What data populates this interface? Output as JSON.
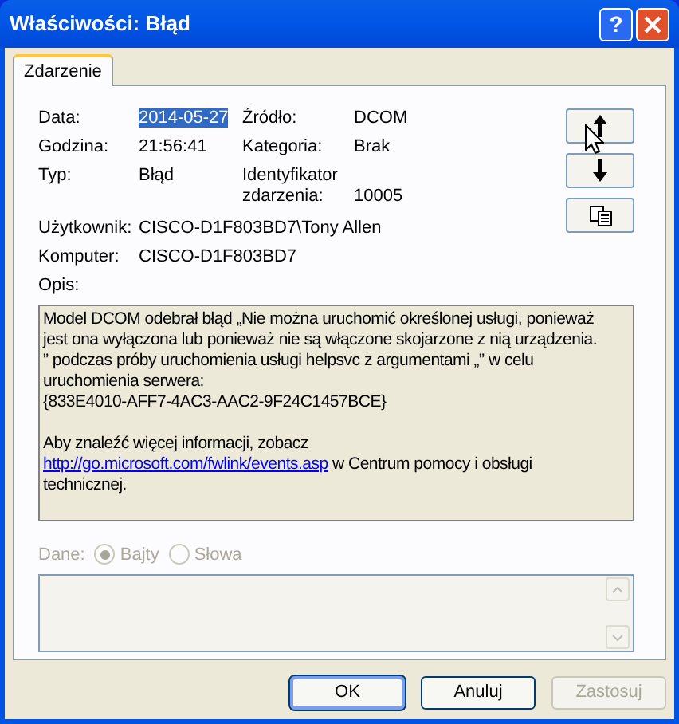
{
  "window": {
    "title": "Właściwości: Błąd",
    "help": "?"
  },
  "tabs": [
    {
      "label": "Zdarzenie",
      "selected": true
    }
  ],
  "header_fields": [
    {
      "label": "Data:",
      "value": "2014-05-27",
      "selected": true
    },
    {
      "label": "Źródło:",
      "value": "DCOM",
      "selected": false
    },
    {
      "label": "Godzina:",
      "value": "21:56:41",
      "selected": false
    },
    {
      "label": "Kategoria:",
      "value": "Brak",
      "selected": false
    },
    {
      "label": "Typ:",
      "value": "Błąd",
      "selected": false
    },
    {
      "label": "Identyfikator\nzdarzenia:",
      "value": "10005",
      "selected": false
    }
  ],
  "wide_fields": [
    {
      "label": "Użytkownik:",
      "value": "CISCO-D1F803BD7\\Tony Allen"
    },
    {
      "label": "Komputer:",
      "value": "CISCO-D1F803BD7"
    }
  ],
  "description": {
    "label": "Opis:",
    "paragraph": "Model DCOM odebrał błąd „Nie można uruchomić określonej usługi, ponieważ\njest ona wyłączona lub ponieważ nie są włączone skojarzone z nią urządzenia.\n” podczas próby uruchomienia usługi helpsvc z argumentami „” w celu\nuruchomienia serwera:\n{833E4010-AFF7-4AC3-AAC2-9F24C1457BCE}",
    "more_text": "Aby znaleźć więcej informacji, zobacz",
    "link": "http://go.microsoft.com/fwlink/events.asp",
    "more_tail": "w Centrum pomocy i obsługi\ntechnicznej."
  },
  "data_section": {
    "label": "Dane:",
    "disabled": true,
    "options": [
      {
        "label": "Bajty",
        "selected": true
      },
      {
        "label": "Słowa",
        "selected": false
      }
    ]
  },
  "buttons": [
    {
      "label": "OK",
      "kind": "default",
      "disabled": false
    },
    {
      "label": "Anuluj",
      "kind": "normal",
      "disabled": false
    },
    {
      "label": "Zastosuj",
      "kind": "normal",
      "disabled": true
    }
  ]
}
